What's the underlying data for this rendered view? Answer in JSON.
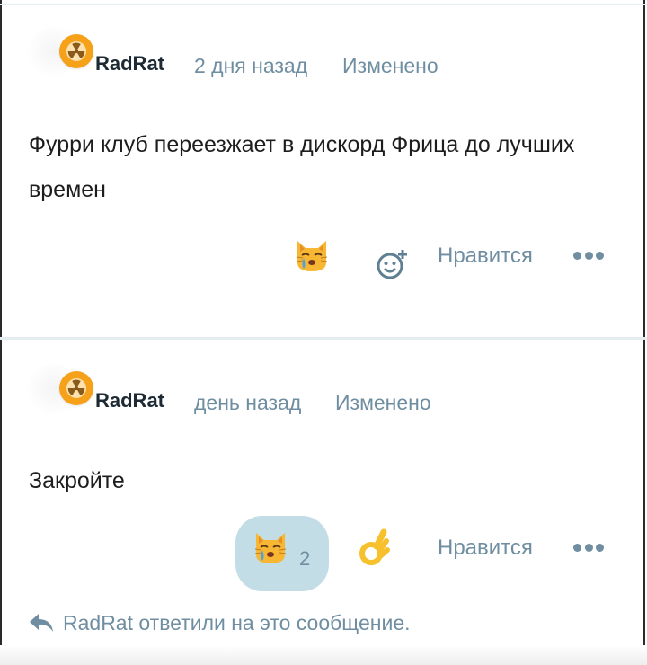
{
  "posts": [
    {
      "author": "RadRat",
      "time": "2 дня назад",
      "edited": "Изменено",
      "body": "Фурри клуб переезжает в дискорд Фрица до лучших времен",
      "reaction_icon": "crying-cat-emoji",
      "like_label": "Нравится",
      "more_icon": "more-dots-icon"
    },
    {
      "author": "RadRat",
      "time": "день назад",
      "edited": "Изменено",
      "body": "Закройте",
      "reaction_icon": "crying-cat-emoji",
      "reaction_count": "2",
      "extra_reaction_icon": "ok-hand-emoji",
      "like_label": "Нравится",
      "more_icon": "more-dots-icon",
      "reply_notice": "RadRat ответили на это сообщение."
    }
  ],
  "colors": {
    "accent_text": "#6f8ea1",
    "avatar_bg": "#f6a11a",
    "reaction_pill_bg": "#c2dde5"
  }
}
